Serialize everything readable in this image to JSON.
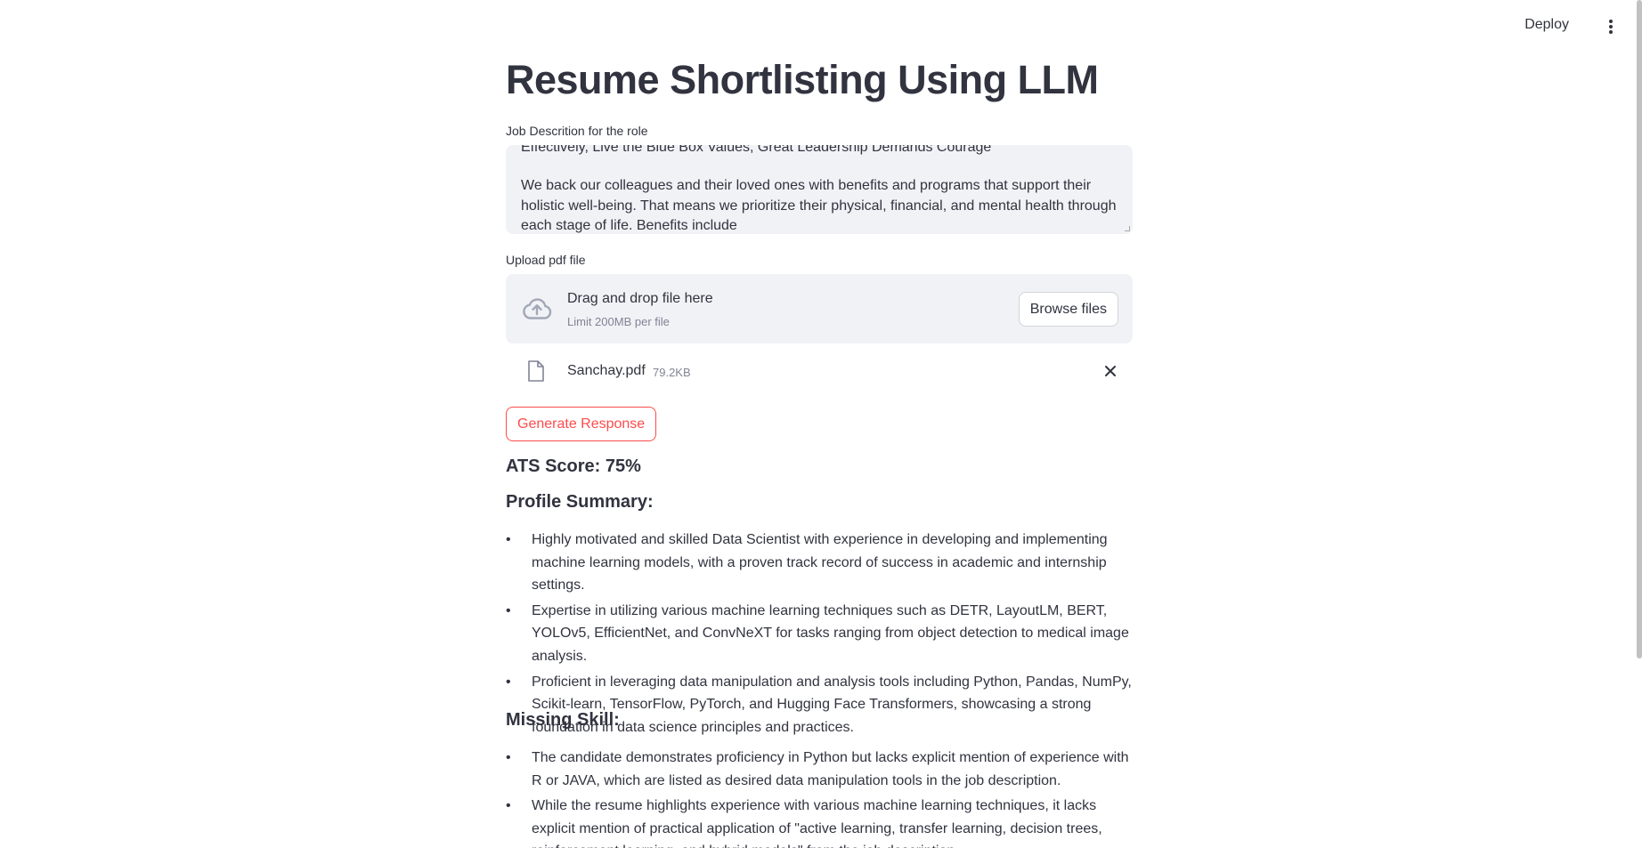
{
  "header": {
    "deploy_label": "Deploy"
  },
  "page": {
    "title": "Resume Shortlisting Using LLM"
  },
  "job_description": {
    "label": "Job Descrition for the role",
    "cut_line": "Effectively, Live the Blue Box Values, Great Leadership Demands Courage",
    "paragraph": "We back our colleagues and their loved ones with benefits and programs that support their holistic well-being. That means we prioritize their physical, financial, and mental health through each stage of life. Benefits include"
  },
  "upload": {
    "label": "Upload pdf file",
    "drop_title": "Drag and drop file here",
    "limit": "Limit 200MB per file",
    "browse_label": "Browse files",
    "file_name": "Sanchay.pdf",
    "file_size": "79.2KB"
  },
  "actions": {
    "generate_label": "Generate Response"
  },
  "result": {
    "ats_score": "ATS Score: 75%",
    "profile_summary_heading": "Profile Summary:",
    "profile_summary": [
      "Highly motivated and skilled Data Scientist with experience in developing and implementing machine learning models, with a proven track record of success in academic and internship settings.",
      "Expertise in utilizing various machine learning techniques such as DETR, LayoutLM, BERT, YOLOv5, EfficientNet, and ConvNeXT for tasks ranging from object detection to medical image analysis.",
      "Proficient in leveraging data manipulation and analysis tools including Python, Pandas, NumPy, Scikit-learn, TensorFlow, PyTorch, and Hugging Face Transformers, showcasing a strong foundation in data science principles and practices."
    ],
    "missing_skill_heading": "Missing Skill:",
    "missing_skill": [
      "The candidate demonstrates proficiency in Python but lacks explicit mention of experience with R or JAVA, which are listed as desired data manipulation tools in the job description.",
      "While the resume highlights experience with various machine learning techniques, it lacks explicit mention of practical application of \"active learning, transfer learning, decision trees, reinforcement learning, and hybrid models\" from the job description."
    ]
  },
  "colors": {
    "accent": "#ff4b4b",
    "text": "#31333f",
    "muted": "#808495",
    "panel": "#f0f2f6"
  },
  "icons": [
    "kebab-menu-icon",
    "cloud-upload-icon",
    "file-icon",
    "close-icon"
  ]
}
